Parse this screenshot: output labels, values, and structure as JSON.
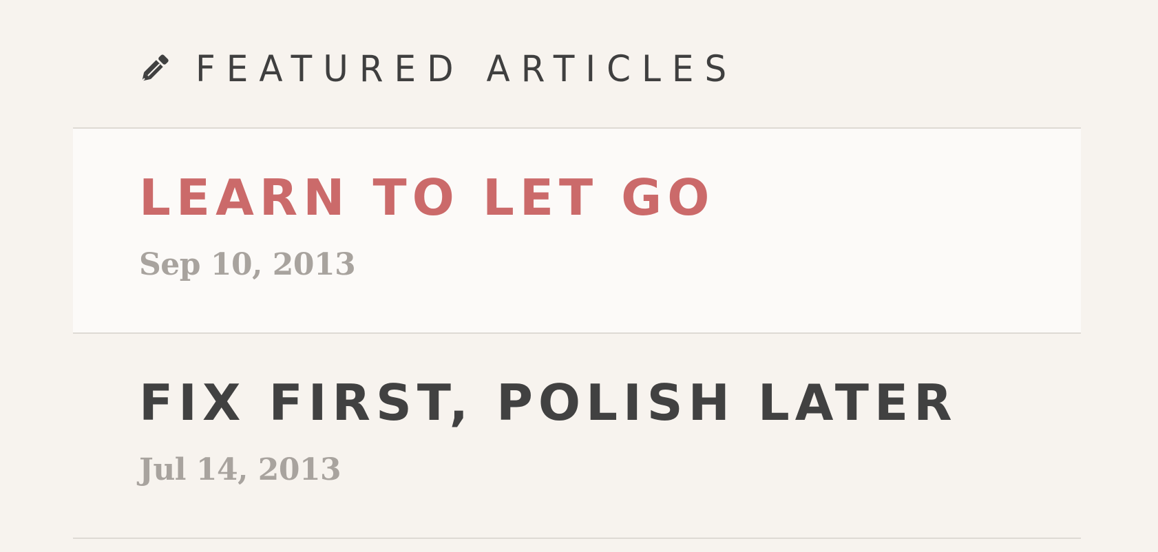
{
  "featured": {
    "icon": "pencil-icon",
    "title": "FEATURED ARTICLES",
    "accent_color": "#cb6a6a",
    "text_color": "#414141",
    "date_color": "#a8a39e",
    "background": "#f7f3ee"
  },
  "articles": [
    {
      "title": "LEARN TO LET GO",
      "date": "Sep 10, 2013",
      "active": true
    },
    {
      "title": "FIX FIRST, POLISH LATER",
      "date": "Jul 14, 2013",
      "active": false
    }
  ]
}
